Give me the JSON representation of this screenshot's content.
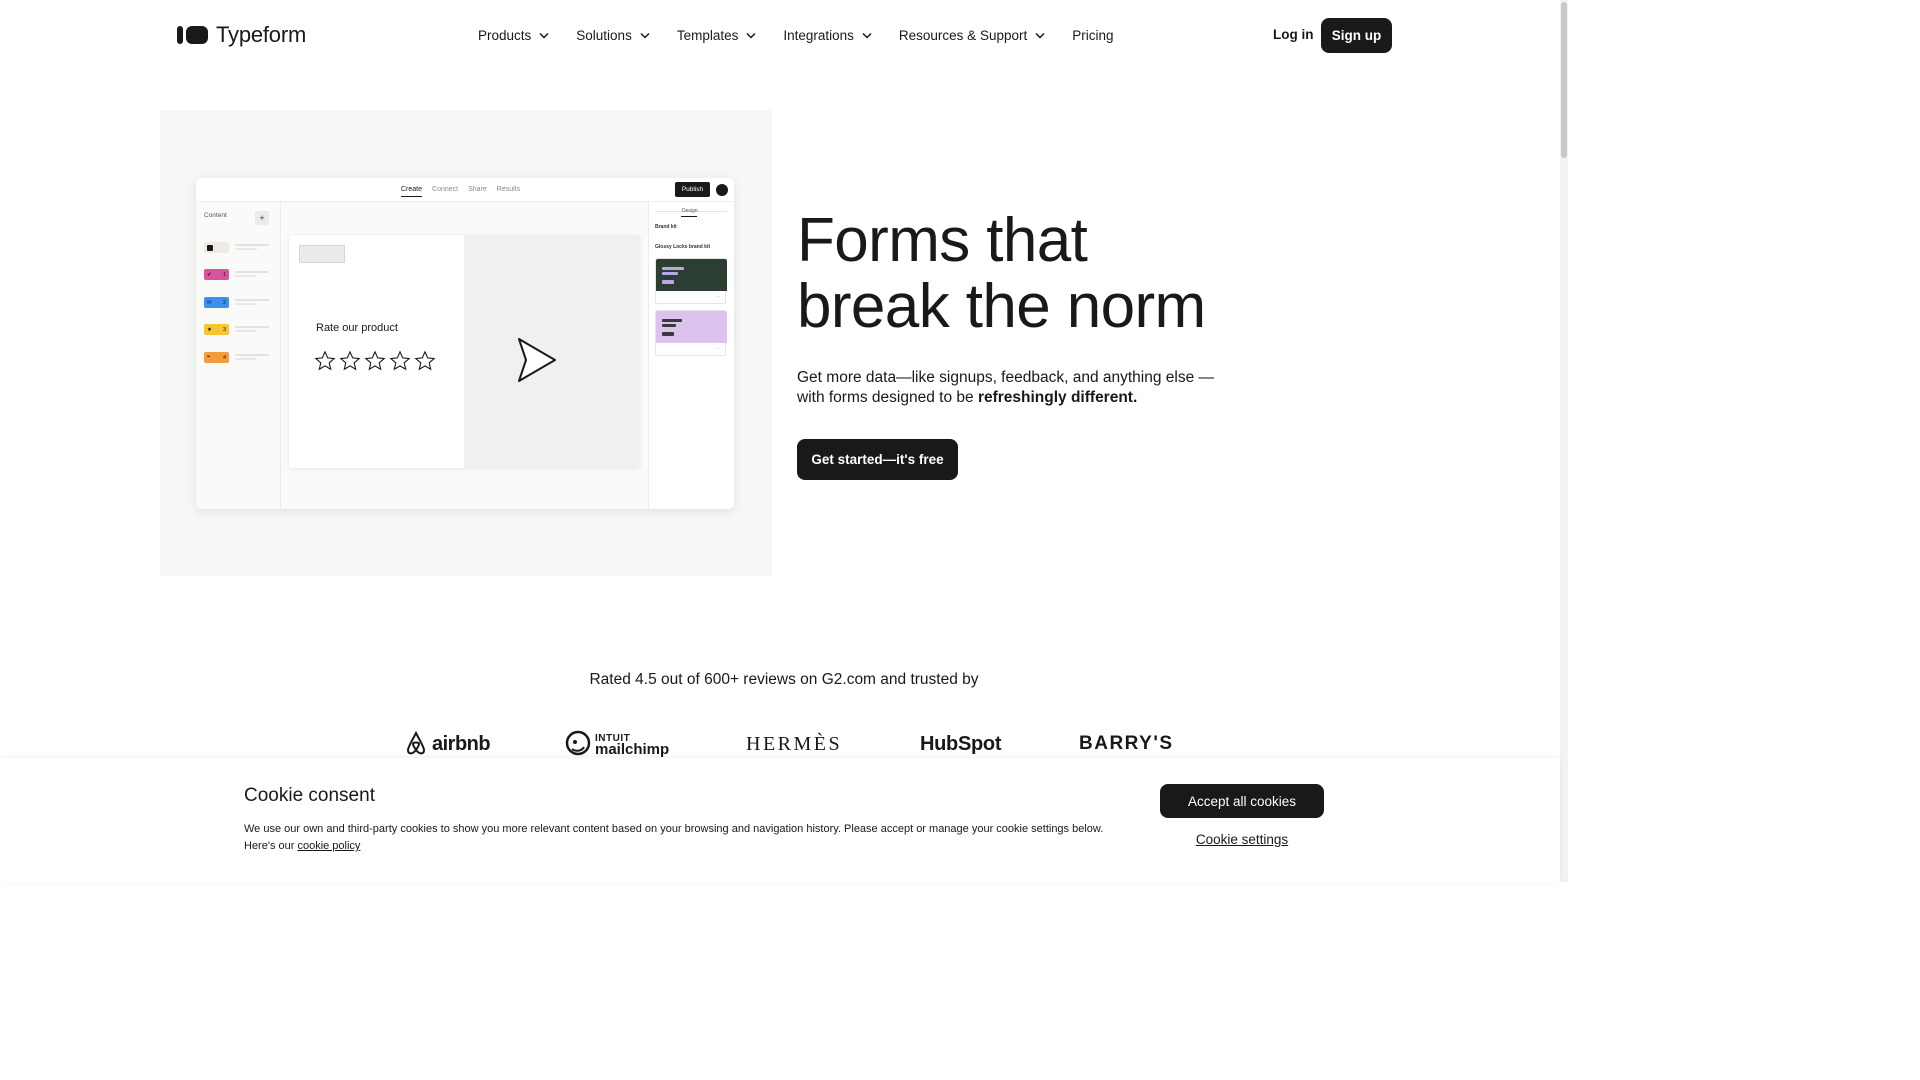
{
  "header": {
    "logo_text": "Typeform",
    "nav": [
      {
        "label": "Products",
        "has_dropdown": true
      },
      {
        "label": "Solutions",
        "has_dropdown": true
      },
      {
        "label": "Templates",
        "has_dropdown": true
      },
      {
        "label": "Integrations",
        "has_dropdown": true
      },
      {
        "label": "Resources & Support",
        "has_dropdown": true
      },
      {
        "label": "Pricing",
        "has_dropdown": false
      }
    ],
    "login_label": "Log in",
    "signup_label": "Sign up"
  },
  "hero": {
    "headline_line1": "Forms that",
    "headline_line2": "break the norm",
    "subcopy_prefix": "Get more data—like signups, feedback, and anything else —with forms designed to be ",
    "subcopy_bold": "refreshingly different.",
    "cta_label": "Get started—it's free"
  },
  "mockup": {
    "tabs": [
      "Create",
      "Connect",
      "Share",
      "Results"
    ],
    "active_tab": "Create",
    "publish_label": "Publish",
    "sidebar_title": "Content",
    "add_label": "+",
    "questions": [
      {
        "number": "",
        "color": "#eeeae6",
        "icon": "welcome-icon"
      },
      {
        "number": "1",
        "color": "#d9539a",
        "icon": "check-icon"
      },
      {
        "number": "2",
        "color": "#3d8ff0",
        "icon": "email-icon"
      },
      {
        "number": "3",
        "color": "#f6c531",
        "icon": "star-icon"
      },
      {
        "number": "4",
        "color": "#f49c3a",
        "icon": "quote-icon"
      }
    ],
    "question_text": "Rate our product",
    "star_count": 5,
    "design_tab": "Design",
    "brand_kit_label": "Brand kit",
    "brand_kit_name": "Glossy Locks brand kit",
    "themes": [
      {
        "background": "#2c3e32",
        "accent": "#b9a5e8"
      },
      {
        "background": "#dcc2ef",
        "accent": "#3a3a3a"
      }
    ],
    "nav_button_color": "#1f4fb8"
  },
  "trust": {
    "rated_text": "Rated 4.5 out of 600+ reviews on G2.com and trusted by",
    "brands": {
      "airbnb": "airbnb",
      "mailchimp_top": "INTUIT",
      "mailchimp_name": "mailchimp",
      "hermes": "HERMÈS",
      "hubspot": "HubSpot",
      "barrys": "BARRY'S"
    }
  },
  "cookie": {
    "title": "Cookie consent",
    "text": "We use our own and third-party cookies to show you more relevant content based on your browsing and navigation history. Please accept or manage your cookie settings below. Here's our ",
    "policy_link": "cookie policy",
    "accept_label": "Accept all cookies",
    "settings_label": "Cookie settings"
  }
}
